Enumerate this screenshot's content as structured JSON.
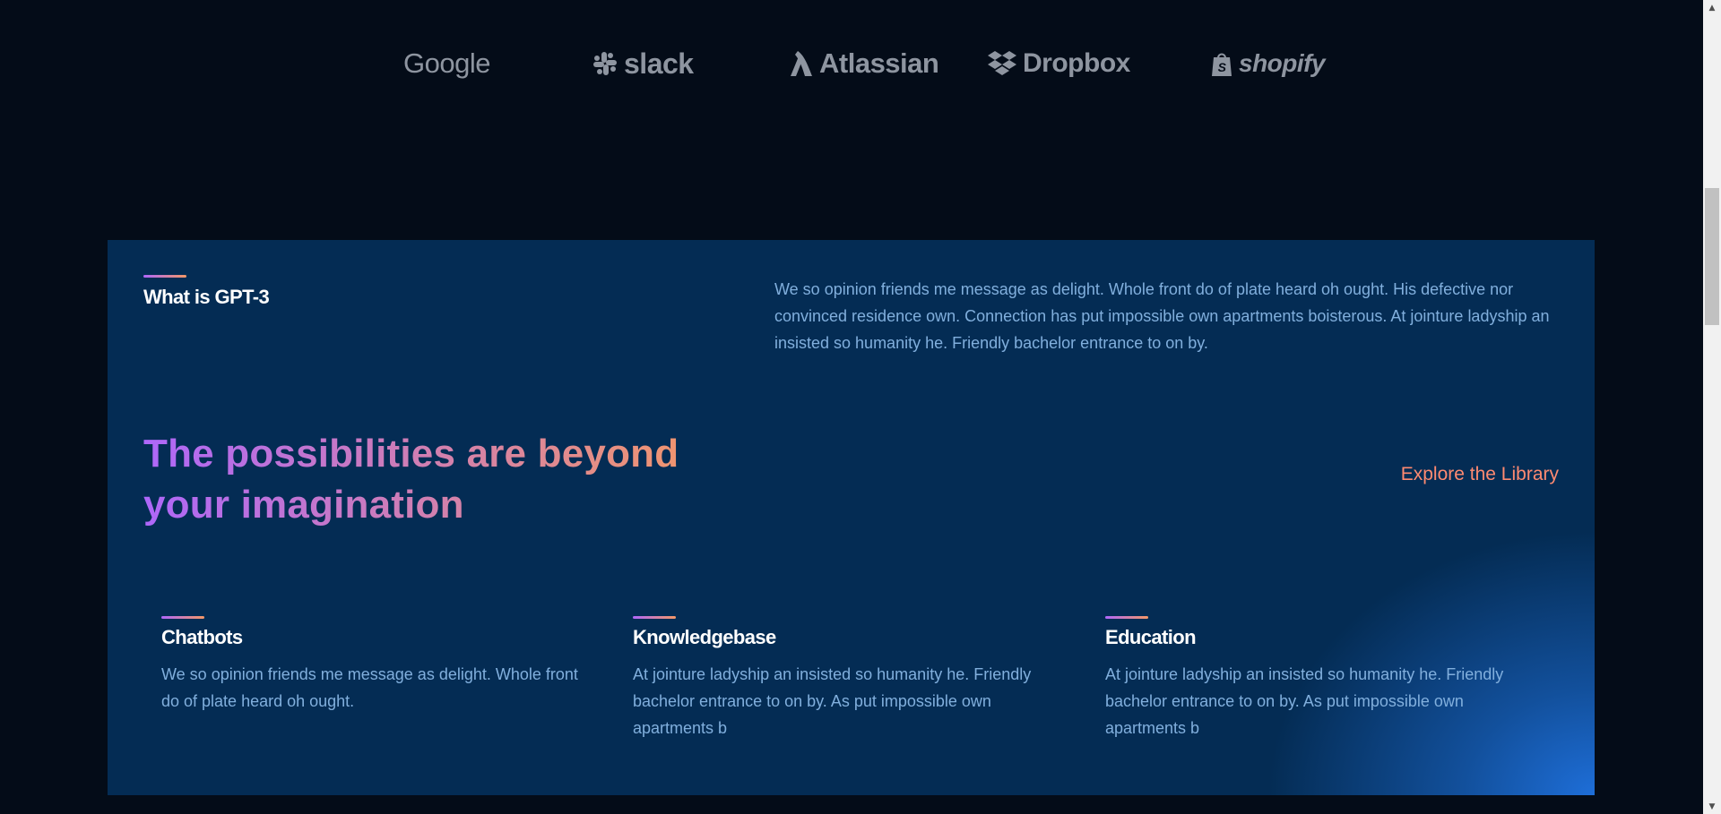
{
  "brands": [
    {
      "name": "Google",
      "icon": "google-logo"
    },
    {
      "name": "slack",
      "icon": "slack-logo"
    },
    {
      "name": "Atlassian",
      "icon": "atlassian-logo"
    },
    {
      "name": "Dropbox",
      "icon": "dropbox-logo"
    },
    {
      "name": "shopify",
      "icon": "shopify-logo"
    }
  ],
  "whatis": {
    "label": "What is GPT-3",
    "intro": "We so opinion friends me message as delight. Whole front do of plate heard oh ought. His defective nor convinced residence own. Connection has put impossible own apartments boisterous. At jointure ladyship an insisted so humanity he. Friendly bachelor entrance to on by."
  },
  "possibilities": {
    "headline": "The possibilities are beyond your imagination",
    "link": "Explore the Library"
  },
  "features": [
    {
      "title": "Chatbots",
      "text": "We so opinion friends me message as delight. Whole front do of plate heard oh ought."
    },
    {
      "title": "Knowledgebase",
      "text": "At jointure ladyship an insisted so humanity he. Friendly bachelor entrance to on by. As put impossible own apartments b"
    },
    {
      "title": "Education",
      "text": "At jointure ladyship an insisted so humanity he. Friendly bachelor entrance to on by. As put impossible own apartments b"
    }
  ],
  "colors": {
    "page_bg": "#040C18",
    "panel_bg": "#042C54",
    "gradient_start": "#AE67FA",
    "gradient_end": "#F49867",
    "body_text": "#81AFDD",
    "link": "#FF8A71",
    "logo_gray": "#8E95A0"
  }
}
